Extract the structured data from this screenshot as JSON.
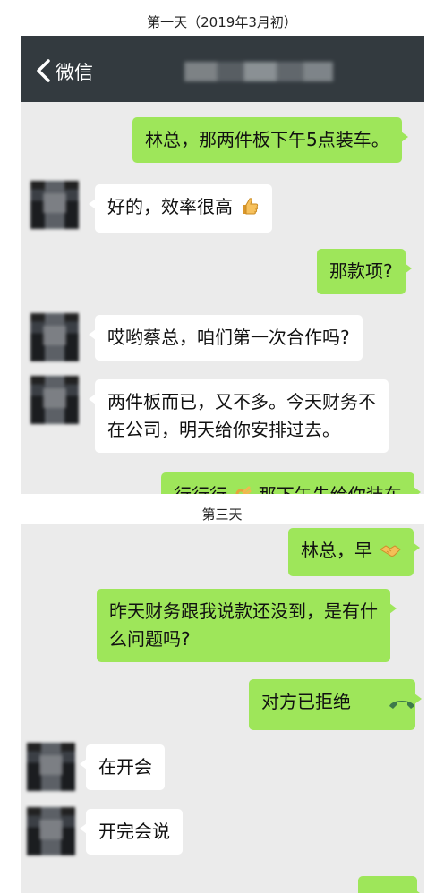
{
  "captions": {
    "day1": "第一天（2019年3月初）",
    "day3": "第三天"
  },
  "chat1": {
    "header": {
      "back_label": "微信"
    },
    "messages": [
      {
        "side": "me",
        "text": "林总，那两件板下午5点装车。"
      },
      {
        "side": "other",
        "text": "好的，效率很高",
        "emoji": "thumbs-up-icon"
      },
      {
        "side": "me",
        "text": "那款项?"
      },
      {
        "side": "other",
        "text": "哎哟蔡总，咱们第一次合作吗?"
      },
      {
        "side": "other",
        "line1": "两件板而已，又不多。今天财务不",
        "line2": "在公司，明天给你安排过去。"
      },
      {
        "side": "me",
        "text": "行行行",
        "emoji": "ok-hand-icon",
        "text_after": "那下午先给你装车"
      }
    ]
  },
  "chat3": {
    "messages": [
      {
        "side": "me",
        "text": "林总，早",
        "emoji": "handshake-icon"
      },
      {
        "side": "me",
        "line1": "昨天财务跟我说款还没到，是有什",
        "line2": "么问题吗?"
      },
      {
        "side": "me",
        "text": "对方已拒绝",
        "icon": "call-declined-icon"
      },
      {
        "side": "other",
        "text": "在开会"
      },
      {
        "side": "other",
        "text": "开完会说"
      }
    ]
  },
  "colors": {
    "my_bubble": "#9ee65a",
    "other_bubble": "#ffffff",
    "chat_bg": "#ebebeb",
    "header_bg": "#333a3f",
    "call_icon": "#3d7a4a"
  }
}
